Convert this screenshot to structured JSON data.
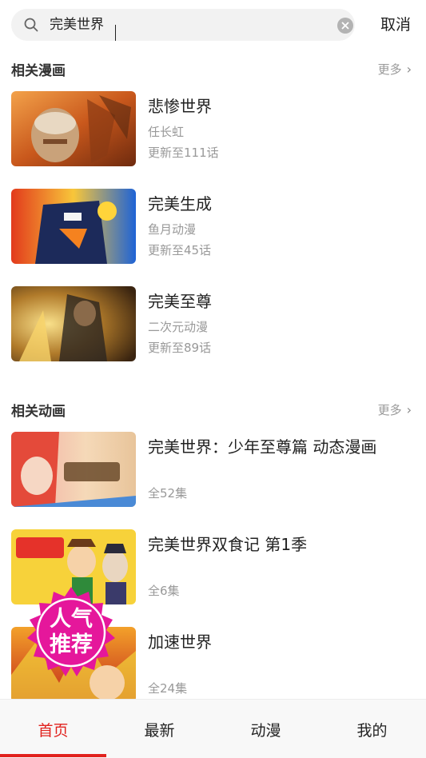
{
  "search": {
    "query": "完美世界",
    "cancel_label": "取消"
  },
  "sections": {
    "comics": {
      "title": "相关漫画",
      "more_label": "更多",
      "items": [
        {
          "title": "悲惨世界",
          "author": "任长虹",
          "progress": "更新至111话"
        },
        {
          "title": "完美生成",
          "author": "鱼月动漫",
          "progress": "更新至45话"
        },
        {
          "title": "完美至尊",
          "author": "二次元动漫",
          "progress": "更新至89话"
        }
      ]
    },
    "anime": {
      "title": "相关动画",
      "more_label": "更多",
      "items": [
        {
          "title": "完美世界：少年至尊篇 动态漫画",
          "episodes": "全52集"
        },
        {
          "title": "完美世界双食记 第1季",
          "episodes": "全6集"
        },
        {
          "title": "加速世界",
          "episodes": "全24集"
        }
      ]
    }
  },
  "promo": {
    "line1": "人气",
    "line2": "推荐"
  },
  "nav": {
    "items": [
      "首页",
      "最新",
      "动漫",
      "我的"
    ],
    "active_index": 0
  },
  "colors": {
    "accent": "#e1221e",
    "promo_pink": "#e5179b",
    "secondary_text": "#999999"
  }
}
